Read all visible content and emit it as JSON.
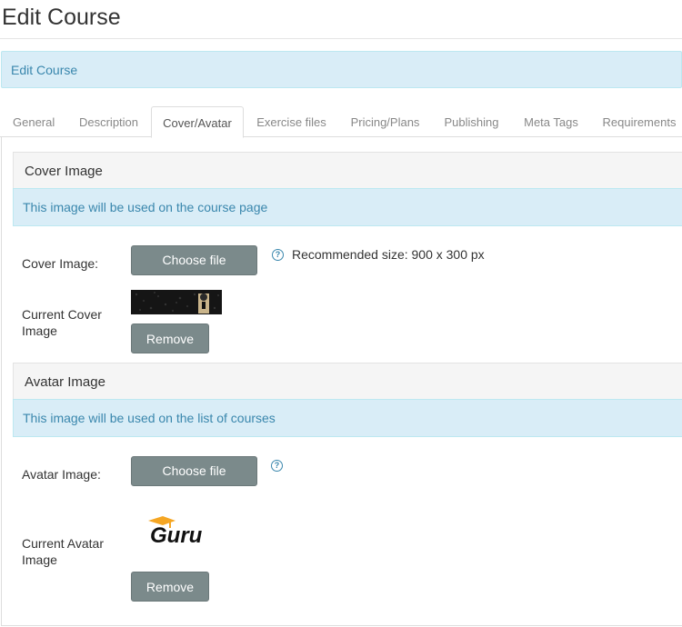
{
  "page": {
    "title": "Edit Course"
  },
  "banner": {
    "text": "Edit Course"
  },
  "tabs": [
    {
      "label": "General"
    },
    {
      "label": "Description"
    },
    {
      "label": "Cover/Avatar"
    },
    {
      "label": "Exercise files"
    },
    {
      "label": "Pricing/Plans"
    },
    {
      "label": "Publishing"
    },
    {
      "label": "Meta Tags"
    },
    {
      "label": "Requirements"
    }
  ],
  "active_tab": "Cover/Avatar",
  "cover": {
    "heading": "Cover Image",
    "note": "This image will be used on the course page",
    "field_label": "Cover Image:",
    "choose_label": "Choose file",
    "hint": "Recommended size: 900 x 300 px",
    "current_label": "Current Cover Image",
    "remove_label": "Remove"
  },
  "avatar": {
    "heading": "Avatar Image",
    "note": "This image will be used on the list of courses",
    "field_label": "Avatar Image:",
    "choose_label": "Choose file",
    "current_label": "Current Avatar Image",
    "remove_label": "Remove",
    "logo_text": "Guru"
  },
  "icons": {
    "help": "help-icon"
  },
  "colors": {
    "info_bg": "#d9edf7",
    "info_text": "#3a87ad",
    "button_bg": "#7b8a8b",
    "logo_orange": "#f5a623"
  }
}
